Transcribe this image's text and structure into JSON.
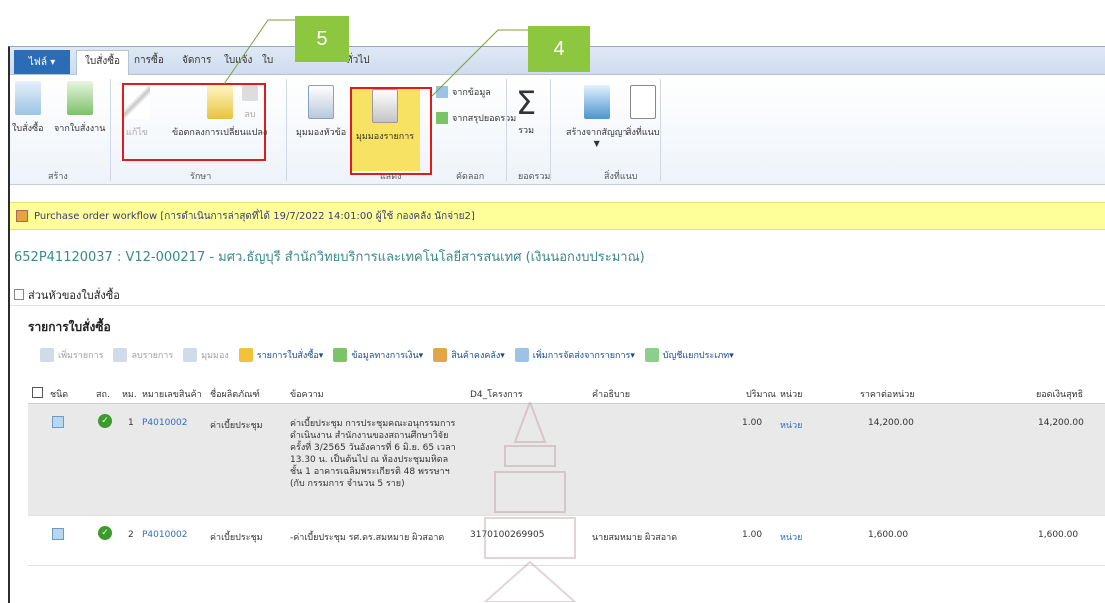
{
  "callouts": {
    "five": "5",
    "four": "4"
  },
  "ribbon": {
    "file_tab": "ไฟล์",
    "tabs": [
      "ใบสั่งซื้อ",
      "การซื้อ",
      "จัดการ",
      "ใบแจ้ง",
      "ใบ",
      "ทั่วไป"
    ],
    "buttons": {
      "new_po": "ใบสั่งซื้อ",
      "from_request": "จากใบสั่งงาน",
      "edit": "แก้ไข",
      "change_request": "ข้อตกลงการเปลี่ยนแปลง",
      "delete": "ลบ",
      "header_view": "มุมมองหัวข้อ",
      "line_view": "มุมมองรายการ",
      "from_data": "จากข้อมูล",
      "from_summary": "จากสรุปยอดรวม",
      "total": "รวม",
      "create_from_contract": "สร้างจากสัญญา",
      "attachments": "สิ่งที่แนบ"
    },
    "groups": {
      "new": "สร้าง",
      "maintain": "รักษา",
      "view": "แสดง",
      "copy": "คัดลอก",
      "totals": "ยอดรวม",
      "attachments": "สิ่งที่แนบ"
    }
  },
  "workflow": {
    "text": "Purchase order workflow [การดำเนินการล่าสุดที่ได้ 19/7/2022 14:01:00 ผู้ใช้ กองคลัง นักจ่าย2]"
  },
  "record": {
    "title": "652P41120037 : V12-000217 - มศว.ธัญบุรี สำนักวิทยบริการและเทคโนโลยีสารสนเทศ (เงินนอกงบประมาณ)"
  },
  "section": {
    "header": "ส่วนหัวของใบสั่งซื้อ"
  },
  "lines": {
    "title": "รายการใบสั่งซื้อ",
    "toolbar": [
      {
        "label": "เพิ่มรายการ",
        "dim": true
      },
      {
        "label": "ลบรายการ",
        "dim": true
      },
      {
        "label": "มุมมอง",
        "dim": true
      },
      {
        "label": "รายการใบสั่งซื้อ▾",
        "dim": false
      },
      {
        "label": "ข้อมูลทางการเงิน▾",
        "dim": false
      },
      {
        "label": "สินค้าคงคลัง▾",
        "dim": false
      },
      {
        "label": "เพิ่มการจัดส่งจากรายการ▾",
        "dim": false
      },
      {
        "label": "บัญชีแยกประเภท▾",
        "dim": false
      }
    ],
    "columns": [
      "ชนิด",
      "สถ.",
      "หม.",
      "หมายเลขสินค้า",
      "ชื่อผลิตภัณฑ์",
      "ข้อความ",
      "D4_โครงการ",
      "คำอธิบาย",
      "ปริมาณ",
      "หน่วย",
      "ราคาต่อหน่วย",
      "ยอดเงินสุทธิ"
    ],
    "rows": [
      {
        "line_no": "1",
        "item_no": "P4010002",
        "product": "ค่าเบี้ยประชุม",
        "text": "ค่าเบี้ยประชุม การประชุมคณะอนุกรรมการดำเนินงาน สำนักงานของสถานศึกษาวิจัย ครั้งที่ 3/2565 วันอังคารที่ 6 มิ.ย. 65 เวลา 13.30 น. เป็นต้นไป ณ ห้องประชุมมหิดล ชั้น 1 อาคารเฉลิมพระเกียรติ 48 พรรษาฯ (กับ กรรมการ จำนวน 5 ราย)",
        "project": "",
        "description": "",
        "qty": "1.00",
        "unit": "หน่วย",
        "unit_price": "14,200.00",
        "net_amount": "14,200.00"
      },
      {
        "line_no": "2",
        "item_no": "P4010002",
        "product": "ค่าเบี้ยประชุม",
        "text": "-ค่าเบี้ยประชุม รศ.ดร.สมหมาย ผิวสอาด",
        "project": "3170100269905",
        "description": "นายสมหมาย ผิวสอาด",
        "qty": "1.00",
        "unit": "หน่วย",
        "unit_price": "1,600.00",
        "net_amount": "1,600.00"
      }
    ]
  }
}
